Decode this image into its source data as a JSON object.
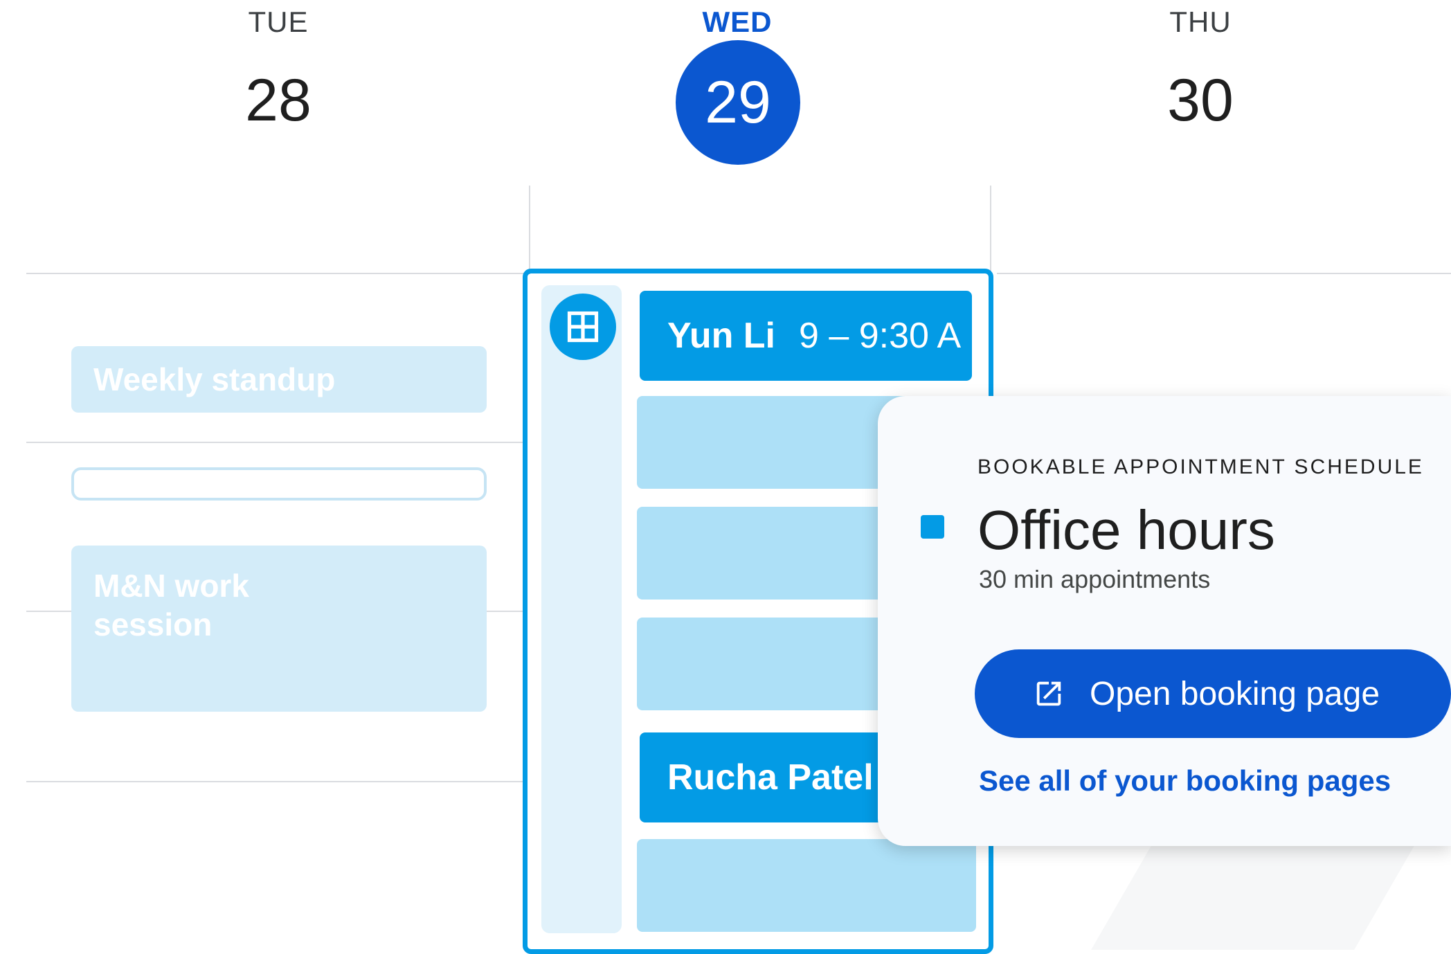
{
  "header": {
    "days": [
      {
        "name": "TUE",
        "number": "28"
      },
      {
        "name": "WED",
        "number": "29"
      },
      {
        "name": "THU",
        "number": "30"
      }
    ]
  },
  "tuesday": {
    "events": [
      {
        "title": "Weekly standup"
      },
      {
        "title": ""
      },
      {
        "title": "M&N work session"
      }
    ]
  },
  "schedule": {
    "icon": "grid-icon",
    "slots": [
      {
        "name": "Yun Li",
        "time": "9 – 9:30 A",
        "booked": true
      },
      {
        "name": "",
        "time": "",
        "booked": false
      },
      {
        "name": "",
        "time": "",
        "booked": false
      },
      {
        "name": "",
        "time": "",
        "booked": false
      },
      {
        "name": "Rucha Patel",
        "time": "",
        "booked": true
      },
      {
        "name": "",
        "time": "",
        "booked": false
      }
    ]
  },
  "popup": {
    "kicker": "BOOKABLE APPOINTMENT SCHEDULE",
    "title": "Office hours",
    "subtitle": "30 min appointments",
    "primary_button": "Open booking page",
    "primary_button_icon": "open-in-new-icon",
    "link": "See all of your booking pages",
    "swatch_color": "#039be5"
  },
  "colors": {
    "accent": "#0b57d0",
    "schedule": "#039be5",
    "slot_available": "#ade0f7",
    "faded_event": "#d3ecf9"
  }
}
